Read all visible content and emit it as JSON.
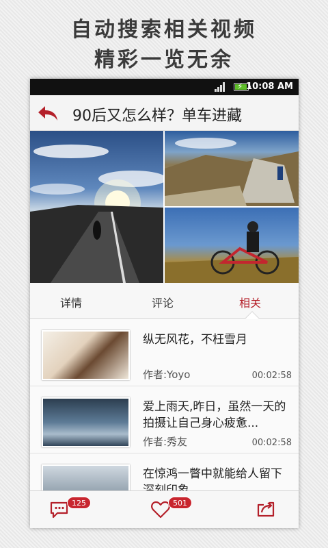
{
  "promo": {
    "line1": "自动搜索相关视频",
    "line2": "精彩一览无余"
  },
  "status_bar": {
    "time": "10:08 AM",
    "icons": [
      "signal-icon",
      "battery-charging-icon"
    ]
  },
  "header": {
    "back_icon": "back-arrow-icon",
    "title": "90后又怎么样？单车进藏"
  },
  "gallery": {
    "images": [
      "road-sunset-photo",
      "cyclist-on-rock-photo",
      "cyclist-with-bike-photo"
    ]
  },
  "tabs": [
    {
      "label": "详情",
      "active": false
    },
    {
      "label": "评论",
      "active": false
    },
    {
      "label": "相关",
      "active": true
    }
  ],
  "related": [
    {
      "title": "纵无风花，不枉雪月",
      "author": "作者:Yoyo",
      "duration": "00:02:58"
    },
    {
      "title": "爱上雨天,昨日，虽然一天的拍摄让自己身心疲惫...",
      "author": "作者:秀友",
      "duration": "00:02:58"
    },
    {
      "title": "在惊鸿一瞥中就能给人留下深刻印象",
      "author": "",
      "duration": ""
    }
  ],
  "bottom_bar": {
    "comment_count": "125",
    "like_count": "501",
    "icons": [
      "comment-icon",
      "heart-icon",
      "share-icon"
    ]
  },
  "colors": {
    "accent": "#b4202a",
    "badge": "#c8252e"
  }
}
